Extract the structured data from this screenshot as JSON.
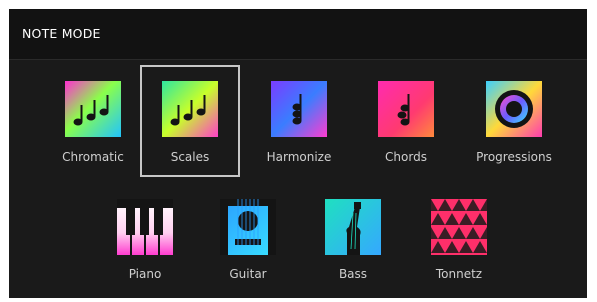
{
  "header": {
    "title": "NOTE MODE"
  },
  "modes": [
    {
      "label": "Chromatic",
      "icon": "chromatic-notes-icon",
      "selected": false
    },
    {
      "label": "Scales",
      "icon": "scales-notes-icon",
      "selected": true
    },
    {
      "label": "Harmonize",
      "icon": "harmonize-icon",
      "selected": false
    },
    {
      "label": "Chords",
      "icon": "chords-icon",
      "selected": false
    },
    {
      "label": "Progressions",
      "icon": "progressions-ring-icon",
      "selected": false
    },
    {
      "label": "Piano",
      "icon": "piano-keys-icon",
      "selected": false
    },
    {
      "label": "Guitar",
      "icon": "acoustic-guitar-icon",
      "selected": false
    },
    {
      "label": "Bass",
      "icon": "electric-bass-icon",
      "selected": false
    },
    {
      "label": "Tonnetz",
      "icon": "tonnetz-triangles-icon",
      "selected": false
    }
  ],
  "colors": {
    "panel": "#1a1a1a",
    "header": "#121212",
    "selection_border": "#c7c7c7",
    "label": "#cfcfcf"
  }
}
